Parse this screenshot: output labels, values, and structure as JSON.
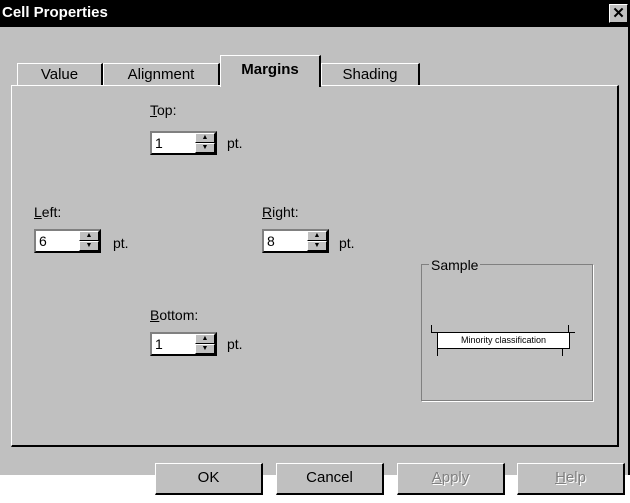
{
  "window": {
    "title": "Cell Properties",
    "close_glyph": "✕"
  },
  "tabs": [
    {
      "label": "Value"
    },
    {
      "label": "Alignment"
    },
    {
      "label": "Margins"
    },
    {
      "label": "Shading"
    }
  ],
  "fields": {
    "top": {
      "mnemonic": "T",
      "rest": "op:",
      "value": "1",
      "unit": "pt."
    },
    "left": {
      "mnemonic": "L",
      "rest": "eft:",
      "value": "6",
      "unit": "pt."
    },
    "right": {
      "mnemonic": "R",
      "rest": "ight:",
      "value": "8",
      "unit": "pt."
    },
    "bottom": {
      "mnemonic": "B",
      "rest": "ottom:",
      "value": "1",
      "unit": "pt."
    }
  },
  "sample": {
    "legend": "Sample",
    "text": "Minority classification"
  },
  "buttons": {
    "ok": "OK",
    "cancel": "Cancel",
    "apply": {
      "mnemonic": "A",
      "rest": "pply"
    },
    "help": {
      "mnemonic": "H",
      "rest": "elp"
    }
  }
}
